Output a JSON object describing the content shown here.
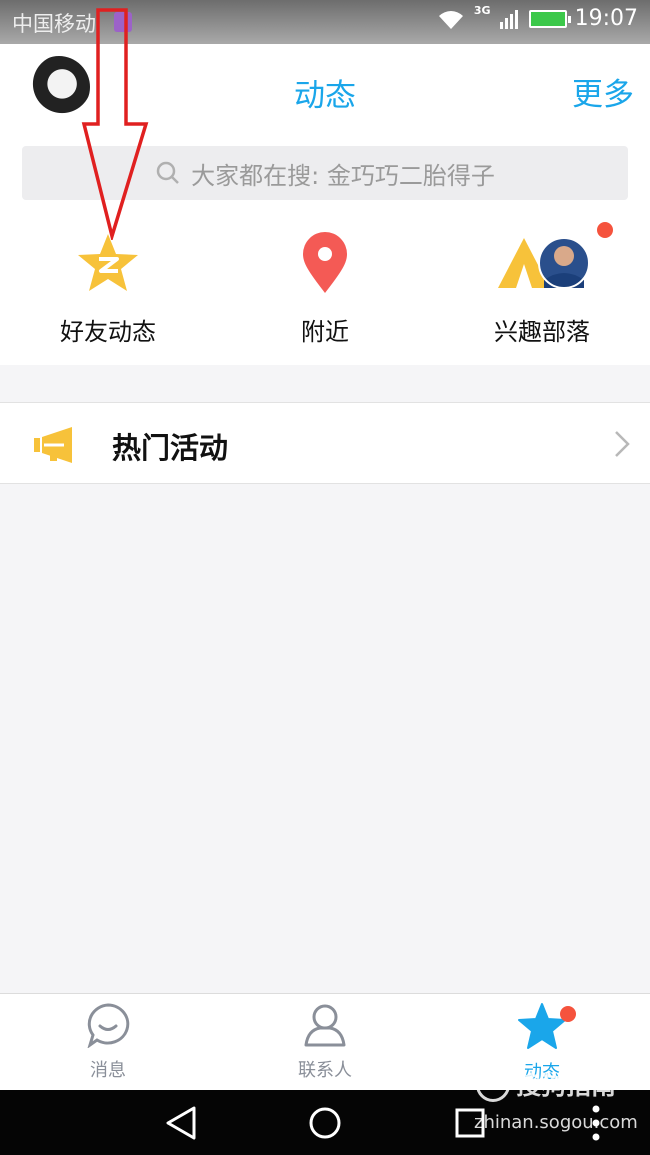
{
  "status_bar": {
    "carrier": "中国移动",
    "network": "3G",
    "time": "19:07"
  },
  "header": {
    "title": "动态",
    "more": "更多"
  },
  "search": {
    "placeholder": "大家都在搜: 金巧巧二胎得子"
  },
  "features": [
    {
      "label": "好友动态",
      "icon": "qzone-star-icon",
      "color": "#f7c23a"
    },
    {
      "label": "附近",
      "icon": "location-pin-icon",
      "color": "#f45a55"
    },
    {
      "label": "兴趣部落",
      "icon": "tribe-tent-icon",
      "color": "#f7c23a"
    }
  ],
  "hot": {
    "label": "热门活动",
    "icon": "megaphone-icon"
  },
  "tabs": [
    {
      "label": "消息",
      "icon": "chat-bubble-icon"
    },
    {
      "label": "联系人",
      "icon": "person-icon"
    },
    {
      "label": "动态",
      "icon": "star-icon",
      "active": true
    }
  ],
  "watermark": {
    "brand": "搜狗指南",
    "url": "zhinan.sogou.com"
  },
  "colors": {
    "accent": "#1aa6ea",
    "badge": "#f5533d",
    "arrow": "#e02020"
  }
}
